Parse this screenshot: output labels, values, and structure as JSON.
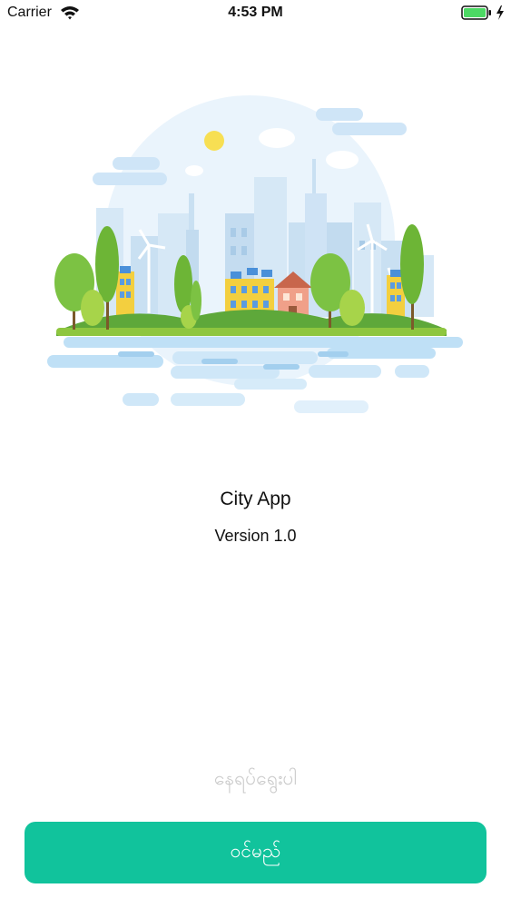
{
  "status_bar": {
    "carrier": "Carrier",
    "time": "4:53 PM",
    "wifi_icon": "wifi-icon",
    "battery_icon": "battery-icon",
    "charging_icon": "lightning-icon"
  },
  "illustration": {
    "icon": "city-skyline-illustration"
  },
  "app": {
    "title": "City App",
    "version": "Version 1.0"
  },
  "actions": {
    "secondary_label": "နေရပ်ရွေးပါ",
    "primary_label": "ဝင်မည်"
  },
  "colors": {
    "primary_button": "#11c39c",
    "secondary_text": "#c9c9c9",
    "sky": "#e6f1fa",
    "tree_green": "#7cc243",
    "water": "#bfe0f6"
  }
}
